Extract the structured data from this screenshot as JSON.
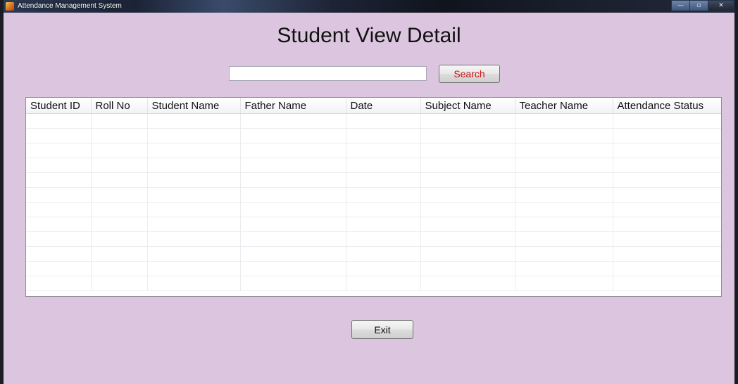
{
  "window": {
    "title": "Attendance Management System",
    "controls": {
      "minimize": "—",
      "maximize": "▫",
      "close": "✕"
    }
  },
  "main": {
    "heading": "Student View Detail",
    "search": {
      "value": "",
      "placeholder": "",
      "button_label": "Search"
    },
    "table": {
      "columns": [
        "Student ID",
        "Roll No",
        "Student Name",
        "Father Name",
        "Date",
        "Subject Name",
        "Teacher Name",
        "Attendance Status"
      ],
      "rows": []
    },
    "exit_label": "Exit"
  },
  "colors": {
    "background": "#dcc6df",
    "search_text": "#cc1111"
  }
}
